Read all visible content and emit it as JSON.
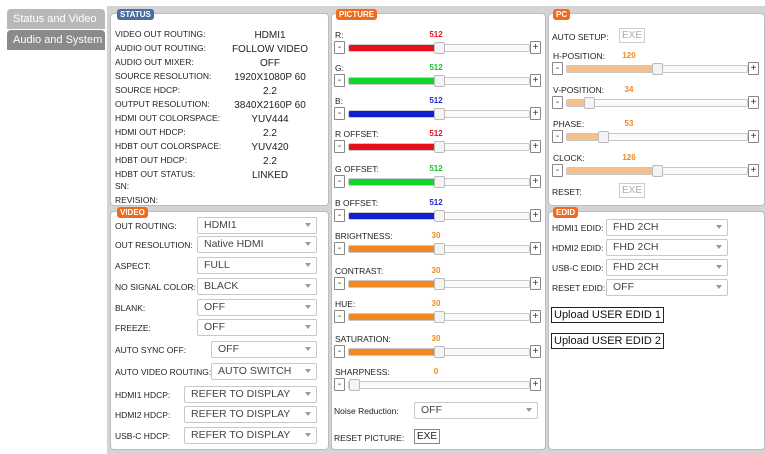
{
  "nav": {
    "tab1": "Status and Video",
    "tab2": "Audio and System"
  },
  "status": {
    "title": "STATUS",
    "rows": [
      {
        "label": "VIDEO OUT ROUTING:",
        "value": "HDMI1"
      },
      {
        "label": "AUDIO OUT ROUTING:",
        "value": "FOLLOW VIDEO"
      },
      {
        "label": "AUDIO OUT MIXER:",
        "value": "OFF"
      },
      {
        "label": "SOURCE RESOLUTION:",
        "value": "1920X1080P 60"
      },
      {
        "label": "SOURCE HDCP:",
        "value": "2.2"
      },
      {
        "label": "OUTPUT RESOLUTION:",
        "value": "3840X2160P 60"
      },
      {
        "label": "HDMI OUT COLORSPACE:",
        "value": "YUV444"
      },
      {
        "label": "HDMI OUT HDCP:",
        "value": "2.2"
      },
      {
        "label": "HDBT OUT COLORSPACE:",
        "value": "YUV420"
      },
      {
        "label": "HDBT OUT HDCP:",
        "value": "2.2"
      },
      {
        "label": "HDBT OUT STATUS:",
        "value": "LINKED"
      },
      {
        "label": "SN:",
        "value": ""
      },
      {
        "label": "REVISION:",
        "value": ""
      }
    ]
  },
  "video": {
    "title": "VIDEO",
    "rows": [
      {
        "label": "OUT ROUTING:",
        "value": "HDMI1"
      },
      {
        "label": "OUT RESOLUTION:",
        "value": "Native HDMI"
      },
      {
        "label": "ASPECT:",
        "value": "FULL"
      },
      {
        "label": "NO SIGNAL COLOR:",
        "value": "BLACK"
      },
      {
        "label": "BLANK:",
        "value": "OFF"
      },
      {
        "label": "FREEZE:",
        "value": "OFF"
      },
      {
        "label": "AUTO SYNC OFF:",
        "value": "OFF"
      },
      {
        "label": "AUTO VIDEO ROUTING:",
        "value": "AUTO SWITCH"
      },
      {
        "label": "HDMI1 HDCP:",
        "value": "REFER TO DISPLAY"
      },
      {
        "label": "HDMI2 HDCP:",
        "value": "REFER TO DISPLAY"
      },
      {
        "label": "USB-C HDCP:",
        "value": "REFER TO DISPLAY"
      }
    ]
  },
  "picture": {
    "title": "PICTURE",
    "sliders": [
      {
        "label": "R:",
        "value": "512",
        "level": 0.5,
        "color": "#e8101a",
        "vcolor": "#e8101a"
      },
      {
        "label": "G:",
        "value": "512",
        "level": 0.5,
        "color": "#11d62a",
        "vcolor": "#19c230"
      },
      {
        "label": "B:",
        "value": "512",
        "level": 0.5,
        "color": "#1020d0",
        "vcolor": "#1a2ad0"
      },
      {
        "label": "R OFFSET:",
        "value": "512",
        "level": 0.5,
        "color": "#e8101a",
        "vcolor": "#e8101a"
      },
      {
        "label": "G OFFSET:",
        "value": "512",
        "level": 0.5,
        "color": "#11d62a",
        "vcolor": "#19c230"
      },
      {
        "label": "B OFFSET:",
        "value": "512",
        "level": 0.5,
        "color": "#1020d0",
        "vcolor": "#1a2ad0"
      },
      {
        "label": "BRIGHTNESS:",
        "value": "30",
        "level": 0.5,
        "color": "#f08a20",
        "vcolor": "#f08a20"
      },
      {
        "label": "CONTRAST:",
        "value": "30",
        "level": 0.5,
        "color": "#f08a20",
        "vcolor": "#f08a20"
      },
      {
        "label": "HUE:",
        "value": "30",
        "level": 0.5,
        "color": "#f08a20",
        "vcolor": "#f08a20"
      },
      {
        "label": "SATURATION:",
        "value": "30",
        "level": 0.5,
        "color": "#f08a20",
        "vcolor": "#f08a20"
      },
      {
        "label": "SHARPNESS:",
        "value": "0",
        "level": 0.0,
        "color": "#f08a20",
        "vcolor": "#f08a20"
      }
    ],
    "noise_label": "Noise Reduction:",
    "noise_value": "OFF",
    "reset_label": "RESET PICTURE:",
    "reset_btn": "EXE",
    "minus": "-",
    "plus": "+"
  },
  "pc": {
    "title": "PC",
    "auto_setup_label": "AUTO SETUP:",
    "auto_setup_btn": "EXE",
    "sliders": [
      {
        "label": "H-POSITION:",
        "value": "120",
        "level": 0.5,
        "color": "#f6c08a",
        "vcolor": "#f08a20"
      },
      {
        "label": "V-POSITION:",
        "value": "34",
        "level": 0.12,
        "color": "#f6c08a",
        "vcolor": "#f08a20"
      },
      {
        "label": "PHASE:",
        "value": "53",
        "level": 0.2,
        "color": "#f6c08a",
        "vcolor": "#f08a20"
      },
      {
        "label": "CLOCK:",
        "value": "126",
        "level": 0.5,
        "color": "#f6c08a",
        "vcolor": "#f08a20"
      }
    ],
    "reset_label": "RESET:",
    "reset_btn": "EXE"
  },
  "edid": {
    "title": "EDID",
    "rows": [
      {
        "label": "HDMI1 EDID:",
        "value": "FHD 2CH"
      },
      {
        "label": "HDMI2 EDID:",
        "value": "FHD 2CH"
      },
      {
        "label": "USB-C EDID:",
        "value": "FHD 2CH"
      },
      {
        "label": "RESET EDID:",
        "value": "OFF"
      }
    ],
    "upload1": "Upload USER EDID 1",
    "upload2": "Upload USER EDID 2"
  }
}
